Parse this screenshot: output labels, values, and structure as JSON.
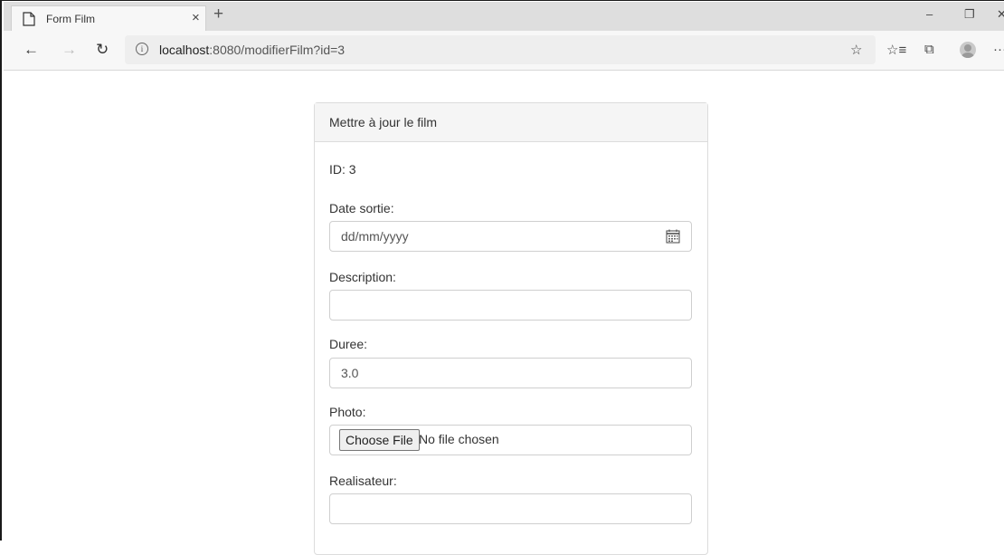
{
  "browser": {
    "tab": {
      "title": "Form Film",
      "close": "×",
      "new_tab": "+"
    },
    "window": {
      "minimize": "–",
      "restore": "❐",
      "close": "✕"
    },
    "nav": {
      "back": "←",
      "forward": "→",
      "refresh": "↻"
    },
    "url": {
      "host": "localhost",
      "path": ":8080/modifierFilm?id=3"
    },
    "toolbar_icons": {
      "favorite": "☆",
      "favorites_list": "☆≡",
      "collections": "⧉",
      "more": "···"
    }
  },
  "form": {
    "header": "Mettre à jour le film",
    "id_text": "ID: 3",
    "date_label": "Date sortie:",
    "date_placeholder": "dd/mm/yyyy",
    "description_label": "Description:",
    "description_value": "",
    "duree_label": "Duree:",
    "duree_value": "3.0",
    "photo_label": "Photo:",
    "file_button": "Choose File",
    "file_status": "No file chosen",
    "realisateur_label": "Realisateur:",
    "realisateur_value": ""
  }
}
